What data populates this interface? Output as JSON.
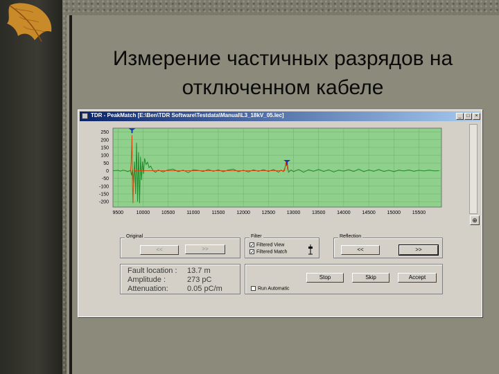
{
  "slide": {
    "title_line1": "Измерение частичных разрядов на",
    "title_line2": "отключенном кабеле"
  },
  "window": {
    "title": "TDR - PeakMatch [E:\\Ben\\TDR Software\\Testdata\\Manual\\L3_18kV_05.lec]",
    "controls": {
      "minimize": "_",
      "maximize": "□",
      "close": "×"
    }
  },
  "chart_data": {
    "type": "line",
    "y_ticks": [
      250,
      200,
      150,
      100,
      50,
      0,
      -50,
      -100,
      -150,
      -200
    ],
    "x_ticks": [
      9500,
      10000,
      10500,
      11000,
      11500,
      12000,
      12500,
      13000,
      13500,
      14000,
      14500,
      15000,
      15500
    ],
    "ylim": [
      -235,
      275
    ],
    "xlim": [
      9400,
      15950
    ],
    "grid": true,
    "background": "#8fd18c",
    "series": [
      {
        "color": "#1f8a28",
        "x": [
          9400,
          9500,
          9550,
          9600,
          9650,
          9700,
          9750,
          9770,
          9790,
          9810,
          9830,
          9850,
          9870,
          9890,
          9910,
          9930,
          9950,
          9970,
          9990,
          10010,
          10030,
          10060,
          10090,
          10120,
          10150,
          10200,
          10250,
          10300,
          10400,
          10500,
          10600,
          10700,
          10800,
          10900,
          11000,
          11100,
          11200,
          11300,
          11400,
          11500,
          11600,
          11700,
          11800,
          11900,
          12000,
          12100,
          12200,
          12300,
          12400,
          12500,
          12600,
          12700,
          12750,
          12800,
          12850,
          12870,
          12900,
          12950,
          13000,
          13100,
          13200,
          13300,
          13400,
          13500,
          13600,
          13700,
          13800,
          13900,
          14000,
          14100,
          14200,
          14300,
          14400,
          14500,
          14600,
          14700,
          14800,
          14900,
          15000,
          15100,
          15200,
          15300,
          15400,
          15500,
          15600,
          15700,
          15800,
          15900
        ],
        "y": [
          0,
          2,
          -3,
          4,
          0,
          -6,
          3,
          -30,
          10,
          -80,
          60,
          -150,
          180,
          -200,
          120,
          -210,
          90,
          -60,
          60,
          -20,
          80,
          40,
          55,
          20,
          30,
          0,
          -10,
          5,
          -8,
          6,
          10,
          -6,
          4,
          -12,
          6,
          2,
          -5,
          8,
          -4,
          6,
          -7,
          5,
          10,
          -6,
          3,
          -8,
          6,
          -4,
          7,
          -5,
          8,
          -10,
          4,
          -6,
          40,
          60,
          -10,
          5,
          -6,
          8,
          -10,
          6,
          -4,
          9,
          -5,
          6,
          -8,
          4,
          -3,
          7,
          -5,
          10,
          -6,
          5,
          -4,
          8,
          -5,
          3,
          -6,
          4,
          -2,
          5,
          -4,
          3,
          -2,
          4,
          -1,
          0
        ]
      },
      {
        "color": "#d04a12",
        "x": [
          9750,
          9760,
          9770,
          9780,
          9790,
          9800,
          9810,
          9820,
          9830,
          9840,
          9850,
          12820,
          12840,
          12850,
          12860,
          12870,
          12880,
          12900
        ],
        "y": [
          0,
          40,
          120,
          230,
          -100,
          -210,
          -60,
          -10,
          10,
          -5,
          0,
          0,
          35,
          60,
          30,
          55,
          10,
          0
        ]
      }
    ],
    "markers": [
      {
        "x": 9780,
        "y": 265,
        "color": "#1b33b5"
      },
      {
        "x": 12870,
        "y": 60,
        "color": "#1b33b5"
      }
    ]
  },
  "panel": {
    "original_label": "Original",
    "original_prev": "<<",
    "original_next": ">>",
    "filter_label": "Filter",
    "filtered_view_label": "Filtered View",
    "filtered_view_checked": "✓",
    "filtered_match_label": "Filtered Match",
    "filtered_match_checked": "✓",
    "reflection_label": "Reflection",
    "reflection_prev": "<<",
    "reflection_next": ">>",
    "fault_location_label": "Fault location :",
    "fault_location_value": "13.7 m",
    "amplitude_label": "Amplitude :",
    "amplitude_value": "273 pC",
    "attenuation_label": "Attenuation:",
    "attenuation_value": "0.05 pC/m",
    "stop_label": "Stop",
    "skip_label": "Skip",
    "accept_label": "Accept",
    "run_automatic_label": "Run Automatic",
    "zoom_icon": "⊕"
  }
}
